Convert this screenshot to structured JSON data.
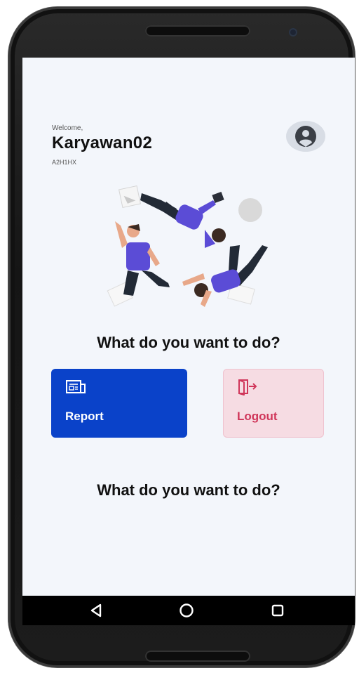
{
  "header": {
    "welcome": "Welcome,",
    "username": "Karyawan02",
    "user_id": "A2H1HX"
  },
  "main": {
    "question_top": "What do you want to do?",
    "question_bottom": "What do you want to do?",
    "actions": [
      {
        "label": "Report",
        "icon": "newspaper-icon",
        "bg": "#0a42c9",
        "color": "#ffffff"
      },
      {
        "label": "Logout",
        "icon": "logout-door-icon",
        "bg": "#f6dce3",
        "color": "#d0365a"
      }
    ]
  },
  "navbar": {
    "buttons": [
      "back-icon",
      "home-icon",
      "recents-icon"
    ]
  },
  "colors": {
    "accent": "#0a42c9",
    "screen_bg": "#f3f6fb",
    "illustration_purple": "#5b4cd6"
  }
}
